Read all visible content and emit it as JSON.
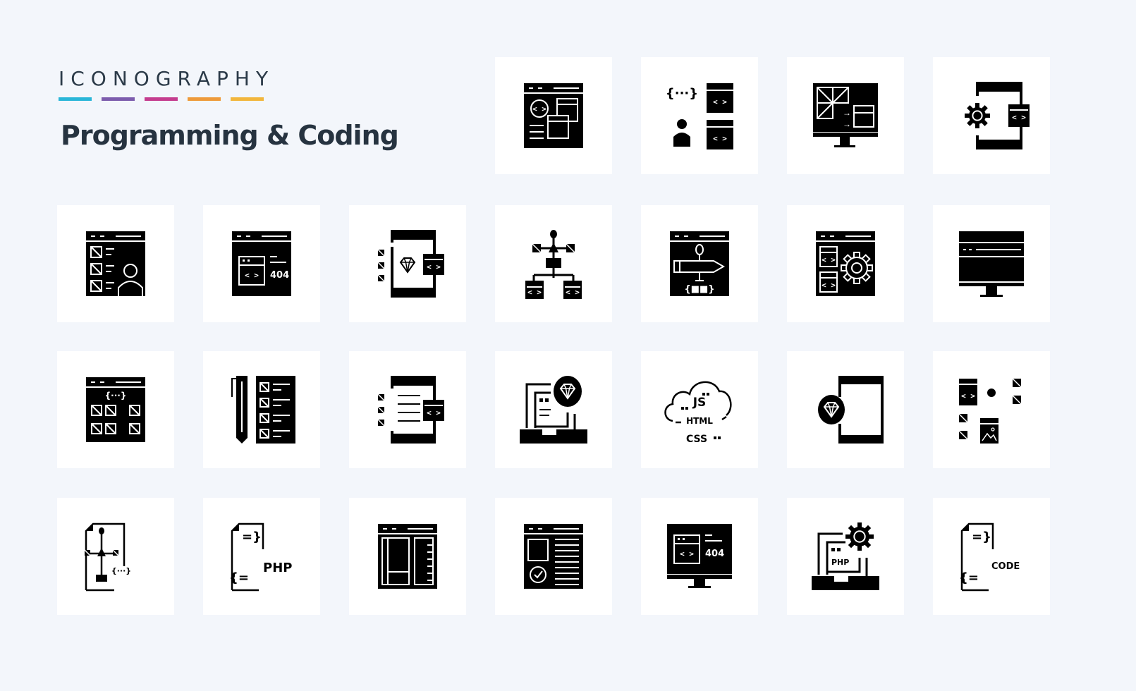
{
  "header": {
    "kicker": "ICONOGRAPHY",
    "title": "Programming & Coding",
    "accent_bars": [
      "#29b6d8",
      "#7c5cad",
      "#c43c8e",
      "#ee9a3a",
      "#f2b63c"
    ]
  },
  "colors": {
    "background": "#f3f6fb",
    "card": "#ffffff",
    "icon": "#000000"
  },
  "icons": [
    {
      "name": "web-layout-code-icon"
    },
    {
      "name": "developer-code-windows-icon"
    },
    {
      "name": "monitor-transform-icon"
    },
    {
      "name": "mobile-settings-code-icon"
    },
    {
      "name": "web-user-checklist-icon"
    },
    {
      "name": "browser-404-icon",
      "text": "404"
    },
    {
      "name": "mobile-diamond-code-icon"
    },
    {
      "name": "vector-hierarchy-icon"
    },
    {
      "name": "browser-design-pen-icon"
    },
    {
      "name": "browser-settings-code-icon"
    },
    {
      "name": "desktop-monitor-icon"
    },
    {
      "name": "browser-grid-code-icon"
    },
    {
      "name": "pencil-checklist-icon"
    },
    {
      "name": "mobile-list-code-icon"
    },
    {
      "name": "laptop-diamond-icon"
    },
    {
      "name": "cloud-web-languages-icon",
      "labels": [
        "JS",
        "HTML",
        "CSS"
      ]
    },
    {
      "name": "mobile-diamond-icon"
    },
    {
      "name": "design-elements-icon"
    },
    {
      "name": "document-vector-icon"
    },
    {
      "name": "php-file-icon",
      "text": "PHP"
    },
    {
      "name": "browser-layout-icon"
    },
    {
      "name": "browser-verified-icon"
    },
    {
      "name": "monitor-404-icon",
      "text": "404"
    },
    {
      "name": "laptop-php-settings-icon",
      "text": "PHP"
    },
    {
      "name": "code-file-icon",
      "text": "CODE"
    }
  ]
}
